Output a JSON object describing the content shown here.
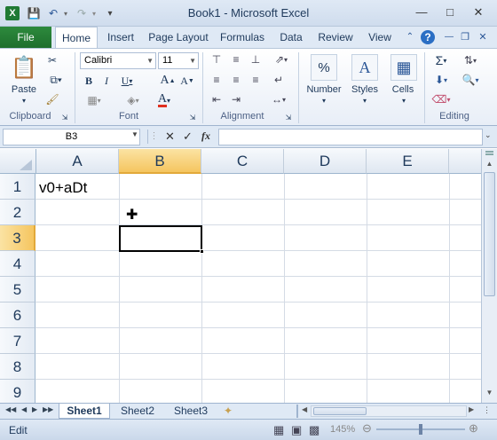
{
  "window": {
    "title": "Book1  -  Microsoft Excel"
  },
  "tabs": [
    "File",
    "Home",
    "Insert",
    "Page Layout",
    "Formulas",
    "Data",
    "Review",
    "View"
  ],
  "ribbon": {
    "font_name": "Calibri",
    "font_size": "11",
    "paste_label": "Paste",
    "number_label": "Number",
    "styles_label": "Styles",
    "cells_label": "Cells",
    "groups": {
      "clipboard": "Clipboard",
      "font": "Font",
      "alignment": "Alignment",
      "editing": "Editing"
    }
  },
  "formula_bar": {
    "name_box": "B3",
    "fx_label": "fx",
    "value": ""
  },
  "columns": [
    "A",
    "B",
    "C",
    "D",
    "E"
  ],
  "rows": [
    "1",
    "2",
    "3",
    "4",
    "5",
    "6",
    "7",
    "8",
    "9"
  ],
  "cells": {
    "A1": "v0+aDt"
  },
  "selected_cell": "B3",
  "sheets": [
    "Sheet1",
    "Sheet2",
    "Sheet3"
  ],
  "status": {
    "mode": "Edit",
    "zoom": "145%"
  }
}
